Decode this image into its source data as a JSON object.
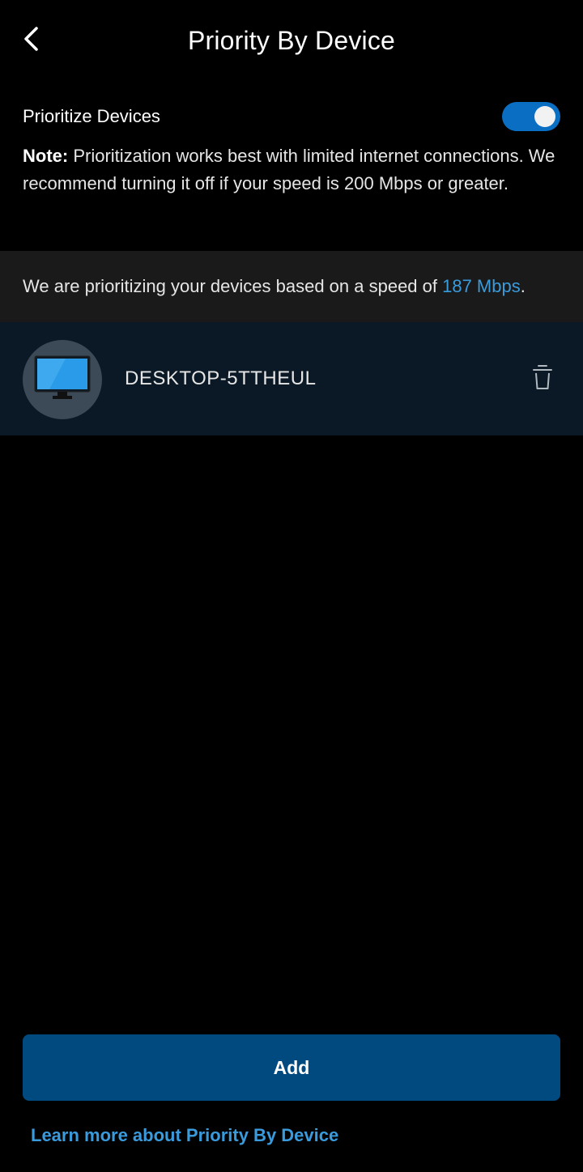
{
  "header": {
    "title": "Priority By Device",
    "back_icon": "chevron-left-icon"
  },
  "prioritize": {
    "label": "Prioritize Devices",
    "enabled": true,
    "toggle_color": "#0a6fc2"
  },
  "note": {
    "prefix": "Note:",
    "text": " Prioritization works best with limited internet connections. We recommend turning it off if your speed is 200 Mbps or greater."
  },
  "speed_banner": {
    "text_before": "We are prioritizing your devices based on a speed of ",
    "speed": "187 Mbps",
    "text_after": "."
  },
  "devices": [
    {
      "name": "DESKTOP-5TTHEUL",
      "icon": "monitor-icon",
      "action_icon": "trash-icon"
    }
  ],
  "actions": {
    "add_label": "Add",
    "learn_more_label": "Learn more about Priority By Device"
  },
  "colors": {
    "background": "#000000",
    "banner": "#1a1a1a",
    "device_row": "#0a1925",
    "primary_button": "#004a80",
    "link": "#3a9bdc"
  }
}
